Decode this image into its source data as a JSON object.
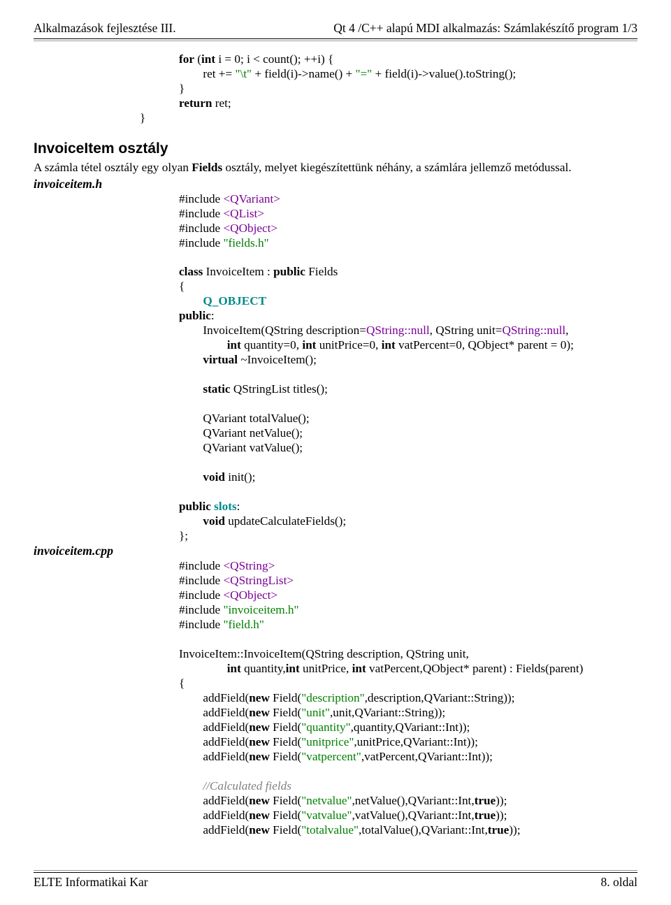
{
  "header": {
    "left": "Alkalmazások fejlesztése III.",
    "right": "Qt 4 /C++ alapú MDI alkalmazás: Számlakészítő program 1/3"
  },
  "footer": {
    "left": "ELTE Informatikai Kar",
    "right": "8. oldal"
  },
  "sections": {
    "invoiceitem_title": "InvoiceItem osztály",
    "para1_a": "A számla tétel osztály egy olyan ",
    "para1_b": "Fields",
    "para1_c": " osztály, melyet kiegészítettünk néhány, a számlára jellemző metódussal.",
    "file_h": "invoiceitem.h",
    "file_cpp": "invoiceitem.cpp"
  },
  "code": {
    "top": {
      "l1a": "for",
      "l1b": " (",
      "l1c": "int",
      "l1d": " i = ",
      "l1e": "0",
      "l1f": "; i < count(); ++i) {",
      "l2a": "ret += ",
      "l2b": "\"\\t\"",
      "l2c": " + field(i)->name() + ",
      "l2d": "\"=\"",
      "l2e": " + field(i)->value().toString();",
      "l3": "}",
      "l4a": "return",
      "l4b": " ret;",
      "l5": "}"
    },
    "h": {
      "i1a": "#include ",
      "i1b": "<QVariant>",
      "i2a": "#include ",
      "i2b": "<QList>",
      "i3a": "#include ",
      "i3b": "<QObject>",
      "i4a": "#include ",
      "i4b": "\"fields.h\"",
      "c1a": "class",
      "c1b": " InvoiceItem : ",
      "c1c": "public",
      "c1d": " Fields",
      "c2": "{",
      "c3": "Q_OBJECT",
      "c4a": "public",
      "c4b": ":",
      "c5a": "InvoiceItem(QString description=",
      "c5b": "QString::null",
      "c5c": ", QString unit=",
      "c5d": "QString::null",
      "c5e": ",",
      "c6a": "int",
      "c6b": " quantity=",
      "c6c": "0",
      "c6d": ", ",
      "c6e": "int",
      "c6f": " unitPrice=",
      "c6g": "0",
      "c6h": ", ",
      "c6i": "int",
      "c6j": " vatPercent=",
      "c6k": "0",
      "c6l": ", QObject* parent = ",
      "c6m": "0",
      "c6n": ");",
      "c7a": "virtual",
      "c7b": " ~InvoiceItem();",
      "c8a": "static",
      "c8b": " QStringList titles();",
      "c9": "QVariant totalValue();",
      "c10": "QVariant netValue();",
      "c11": "QVariant vatValue();",
      "c12a": "void",
      "c12b": " init();",
      "c13a": "public",
      "c13b": " ",
      "c13c": "slots",
      "c13d": ":",
      "c14a": "void",
      "c14b": " updateCalculateFields();",
      "c15": "};"
    },
    "cpp": {
      "i1a": "#include ",
      "i1b": "<QString>",
      "i2a": "#include ",
      "i2b": "<QStringList>",
      "i3a": "#include ",
      "i3b": "<QObject>",
      "i4a": "#include ",
      "i4b": "\"invoiceitem.h\"",
      "i5a": "#include ",
      "i5b": "\"field.h\"",
      "f1": "InvoiceItem::InvoiceItem(QString description, QString unit,",
      "f2a": "int",
      "f2b": " quantity,",
      "f2c": "int",
      "f2d": " unitPrice, ",
      "f2e": "int",
      "f2f": " vatPercent,QObject* parent) : Fields(parent)",
      "f3": "{",
      "a1a": "addField(",
      "a1b": "new",
      "a1c": " Field(",
      "a1d": "\"description\"",
      "a1e": ",description,QVariant::String));",
      "a2a": "addField(",
      "a2b": "new",
      "a2c": " Field(",
      "a2d": "\"unit\"",
      "a2e": ",unit,QVariant::String));",
      "a3a": "addField(",
      "a3b": "new",
      "a3c": " Field(",
      "a3d": "\"quantity\"",
      "a3e": ",quantity,QVariant::Int));",
      "a4a": "addField(",
      "a4b": "new",
      "a4c": " Field(",
      "a4d": "\"unitprice\"",
      "a4e": ",unitPrice,QVariant::Int));",
      "a5a": "addField(",
      "a5b": "new",
      "a5c": " Field(",
      "a5d": "\"vatpercent\"",
      "a5e": ",vatPercent,QVariant::Int));",
      "com": "//Calculated fields",
      "a6a": "addField(",
      "a6b": "new",
      "a6c": " Field(",
      "a6d": "\"netvalue\"",
      "a6e": ",netValue(),QVariant::Int,",
      "a6f": "true",
      "a6g": "));",
      "a7a": "addField(",
      "a7b": "new",
      "a7c": " Field(",
      "a7d": "\"vatvalue\"",
      "a7e": ",vatValue(),QVariant::Int,",
      "a7f": "true",
      "a7g": "));",
      "a8a": "addField(",
      "a8b": "new",
      "a8c": " Field(",
      "a8d": "\"totalvalue\"",
      "a8e": ",totalValue(),QVariant::Int,",
      "a8f": "true",
      "a8g": "));"
    }
  }
}
